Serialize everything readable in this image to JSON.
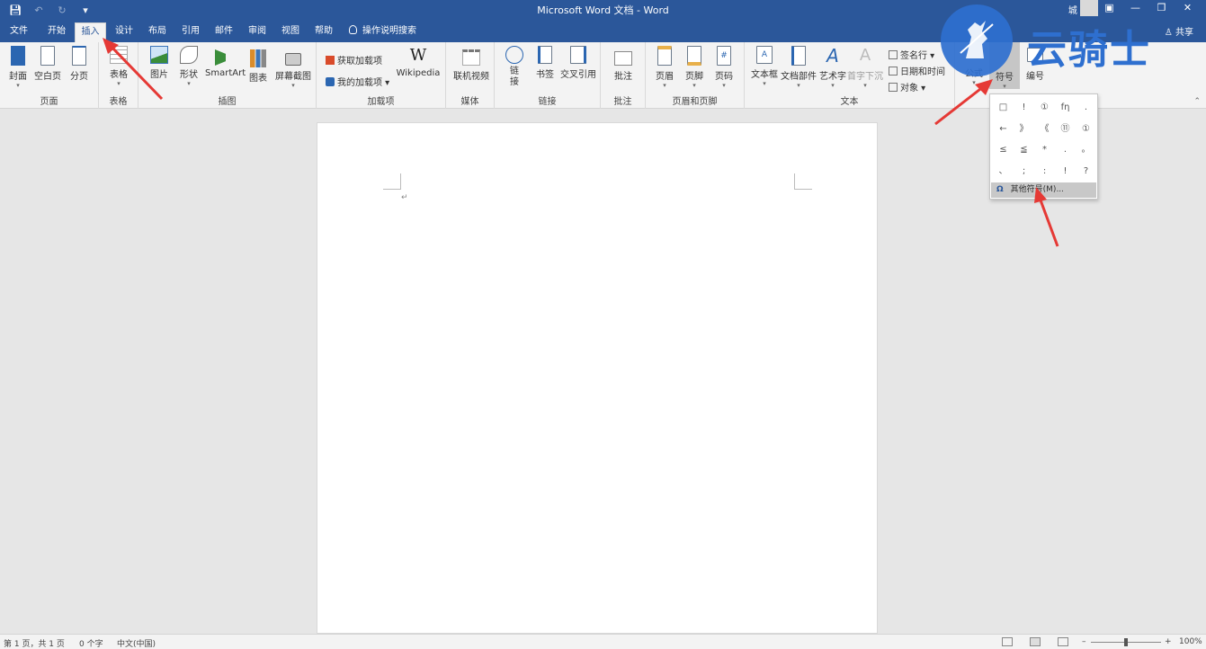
{
  "window": {
    "title": "Microsoft Word 文档  -  Word",
    "user": "城 冠晴",
    "quick_access": [
      "save-icon",
      "undo-icon",
      "redo-icon",
      "customize-icon"
    ]
  },
  "tabs": [
    {
      "label": "文件"
    },
    {
      "label": "开始"
    },
    {
      "label": "插入",
      "active": true
    },
    {
      "label": "设计"
    },
    {
      "label": "布局"
    },
    {
      "label": "引用"
    },
    {
      "label": "邮件"
    },
    {
      "label": "审阅"
    },
    {
      "label": "视图"
    },
    {
      "label": "帮助"
    },
    {
      "label": "操作说明搜索"
    }
  ],
  "share_label": "共享",
  "ribbon": {
    "pages": {
      "label": "页面",
      "cover": "封面",
      "blank": "空白页",
      "break": "分页"
    },
    "tables": {
      "label": "表格",
      "table": "表格"
    },
    "illustrations": {
      "label": "插图",
      "picture": "图片",
      "shapes": "形状",
      "smartart": "SmartArt",
      "chart": "图表",
      "screenshot": "屏幕截图"
    },
    "addins": {
      "label": "加载项",
      "get": "获取加载项",
      "mine": "我的加载项",
      "wiki": "Wikipedia"
    },
    "media": {
      "label": "媒体",
      "video": "联机视频"
    },
    "links": {
      "label": "链接",
      "link": "链接",
      "bookmark": "书签",
      "crossref": "交叉引用"
    },
    "comments": {
      "label": "批注",
      "comment": "批注"
    },
    "header_footer": {
      "label": "页眉和页脚",
      "header": "页眉",
      "footer": "页脚",
      "page_number": "页码"
    },
    "text": {
      "label": "文本",
      "textbox": "文本框",
      "quickparts": "文档部件",
      "wordart": "艺术字",
      "dropcap": "首字下沉",
      "signature": "签名行",
      "datetime": "日期和时间",
      "object": "对象"
    },
    "symbols": {
      "equation": "公式",
      "symbol": "符号",
      "numbering": "编号"
    }
  },
  "symbol_dropdown": {
    "symbols": [
      "□",
      "!",
      "①",
      "fη",
      ".",
      "←",
      "》",
      "《",
      "⑪",
      "①",
      "≤",
      "≦",
      "*",
      ".",
      "。",
      "、",
      ";",
      ":",
      "!",
      "?"
    ],
    "more_label": "其他符号(M)..."
  },
  "document": {
    "paragraph_mark": "↵"
  },
  "status": {
    "page": "第 1 页，共 1 页",
    "words": "0 个字",
    "language": "中文(中国)",
    "zoom": "100%"
  },
  "watermark": {
    "text": "云骑士"
  },
  "colors": {
    "accent": "#2b579a",
    "ribbon_bg": "#f3f3f3",
    "canvas_bg": "#e6e6e6",
    "arrow": "#e53935",
    "watermark": "#2e6fcf"
  }
}
